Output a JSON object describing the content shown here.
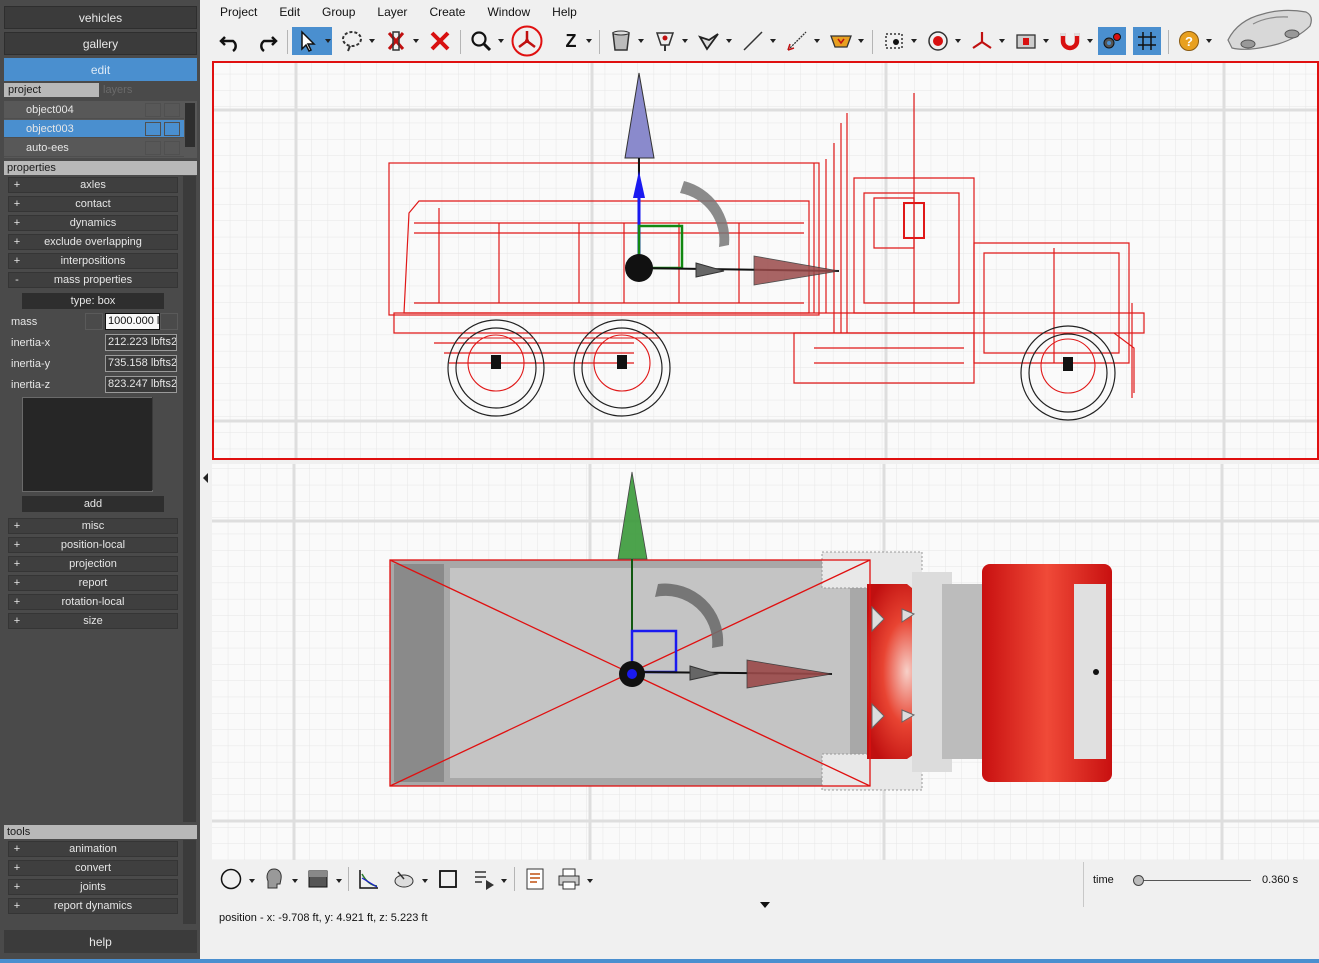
{
  "nav": {
    "vehicles": "vehicles",
    "gallery": "gallery",
    "edit": "edit",
    "help": "help"
  },
  "tabs": {
    "project": "project",
    "layers": "layers"
  },
  "objects": [
    "object004",
    "object003",
    "auto-ees"
  ],
  "selected_object": "object003",
  "properties": {
    "header": "properties",
    "groups_top": [
      {
        "sign": "+",
        "label": "axles"
      },
      {
        "sign": "+",
        "label": "contact"
      },
      {
        "sign": "+",
        "label": "dynamics"
      },
      {
        "sign": "+",
        "label": "exclude overlapping"
      },
      {
        "sign": "+",
        "label": "interpositions"
      },
      {
        "sign": "-",
        "label": "mass properties"
      }
    ],
    "type": "type: box",
    "fields": [
      {
        "label": "mass",
        "value": "1000.000 l"
      },
      {
        "label": "inertia-x",
        "value": "212.223 lbfts2"
      },
      {
        "label": "inertia-y",
        "value": "735.158 lbfts2"
      },
      {
        "label": "inertia-z",
        "value": "823.247 lbfts2"
      }
    ],
    "add_label": "add",
    "groups_bottom": [
      {
        "sign": "+",
        "label": "misc"
      },
      {
        "sign": "+",
        "label": "position-local"
      },
      {
        "sign": "+",
        "label": "projection"
      },
      {
        "sign": "+",
        "label": "report"
      },
      {
        "sign": "+",
        "label": "rotation-local"
      },
      {
        "sign": "+",
        "label": "size"
      }
    ]
  },
  "tools": {
    "header": "tools",
    "items": [
      {
        "sign": "+",
        "label": "animation"
      },
      {
        "sign": "+",
        "label": "convert"
      },
      {
        "sign": "+",
        "label": "joints"
      },
      {
        "sign": "+",
        "label": "report dynamics"
      }
    ]
  },
  "menu": [
    "Project",
    "Edit",
    "Group",
    "Layer",
    "Create",
    "Window",
    "Help"
  ],
  "toolbar_icons": [
    "undo-icon",
    "redo-icon",
    "select-arrow-icon",
    "lasso-icon",
    "cut-icon",
    "delete-icon",
    "zoom-icon",
    "axis-gizmo-icon",
    "z-axis-icon",
    "bucket-icon",
    "pin-icon",
    "plane-icon",
    "line-icon",
    "measure-icon",
    "tag-icon",
    "camera-target-icon",
    "record-icon",
    "axes-icon",
    "snapshot-icon",
    "magnet-icon",
    "gears-icon",
    "grid-icon",
    "help-icon"
  ],
  "z_label": "Z",
  "status": {
    "position": "position - x: -9.708 ft, y: 4.921 ft, z: 5.223 ft"
  },
  "time": {
    "label": "time",
    "value": "0.360 s",
    "fraction": 0.0
  },
  "colors": {
    "accent": "#4a8fcf",
    "selection": "#e01010",
    "panel": "#4a4a4a",
    "truck_red": "#e42a1a"
  }
}
